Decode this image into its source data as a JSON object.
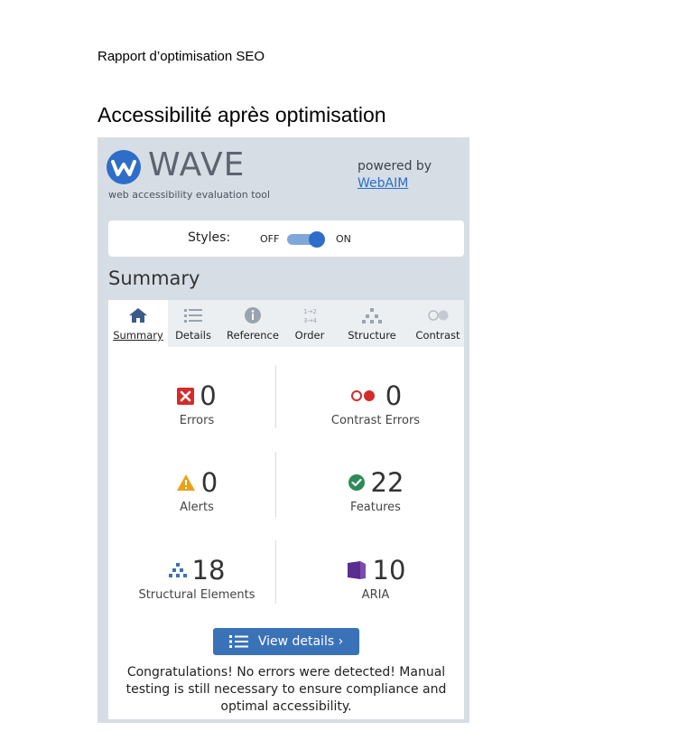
{
  "document": {
    "title": "Rapport d’optimisation SEO",
    "heading": "Accessibilité après optimisation"
  },
  "wave": {
    "logo_text": "WAVE",
    "subtitle": "web accessibility evaluation tool",
    "powered_by": "powered by",
    "webaim_link": "WebAIM",
    "styles_label": "Styles:",
    "styles_off": "OFF",
    "styles_on": "ON",
    "styles_state": "on",
    "summary_heading": "Summary",
    "tabs": [
      {
        "label": "Summary",
        "icon": "home-icon",
        "active": true
      },
      {
        "label": "Details",
        "icon": "list-icon",
        "active": false
      },
      {
        "label": "Reference",
        "icon": "info-icon",
        "active": false
      },
      {
        "label": "Order",
        "icon": "order-icon",
        "active": false
      },
      {
        "label": "Structure",
        "icon": "structure-icon",
        "active": false
      },
      {
        "label": "Contrast",
        "icon": "contrast-icon",
        "active": false
      }
    ],
    "stats": {
      "errors": {
        "value": "0",
        "label": "Errors",
        "icon": "error-x-icon",
        "color": "#d42b2b"
      },
      "contrast_errors": {
        "value": "0",
        "label": "Contrast Errors",
        "icon": "contrast-error-icon",
        "color": "#d42b2b"
      },
      "alerts": {
        "value": "0",
        "label": "Alerts",
        "icon": "alert-triangle-icon",
        "color": "#e8a21a"
      },
      "features": {
        "value": "22",
        "label": "Features",
        "icon": "feature-check-icon",
        "color": "#2e8a57"
      },
      "structural": {
        "value": "18",
        "label": "Structural Elements",
        "icon": "structure-tree-icon",
        "color": "#3a72b8"
      },
      "aria": {
        "value": "10",
        "label": "ARIA",
        "icon": "aria-cube-icon",
        "color": "#5b2d8e"
      }
    },
    "view_details": "View details ›",
    "congrats": "Congratulations! No errors were detected! Manual testing is still necessary to ensure compliance and optimal accessibility."
  }
}
